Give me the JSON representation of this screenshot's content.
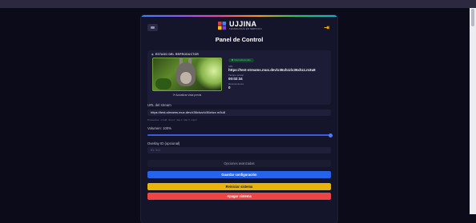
{
  "brand": {
    "name": "UJJINA",
    "tagline": "TECNOLOGÍA EN SERVICIO",
    "colors": {
      "accent": "#2563eb",
      "warning": "#eab308",
      "danger": "#ef4444",
      "success": "#34d27a"
    }
  },
  "header": {
    "title": "Panel de Control",
    "menu_icon": "menu-icon",
    "exit_icon": "logout-icon"
  },
  "player_status": {
    "label": "ESTADO DEL REPRODUCTOR",
    "state_badge": "Reproduciendo",
    "url_label": "URL",
    "url_value": "https://test-streams.mux.dev/x36xhzz/x36xhzz.m3u8",
    "time_label": "Tiempo actual",
    "time_value": "00:02:34",
    "reconnect_label": "Reconexiones",
    "reconnect_value": "0",
    "thumbnail_caption": "Actualizar vista previa"
  },
  "stream": {
    "url_label": "URL del stream",
    "url_value": "https://test-streams.mux.dev/x36xhzz/x36xhzz.m3u8",
    "hint": "Protocolos: .m3u8, rtmp://, rtsp://, http://, udp://"
  },
  "volume": {
    "label": "Volumen: 100%",
    "level_percent": 100
  },
  "overlay": {
    "label": "Overlay ID (opcional)",
    "placeholder": "ID: 5.0"
  },
  "buttons": {
    "advanced": "Opciones avanzadas",
    "save": "Guardar configuración",
    "restart": "Reiniciar sistema",
    "shutdown": "Apagar sistema"
  }
}
